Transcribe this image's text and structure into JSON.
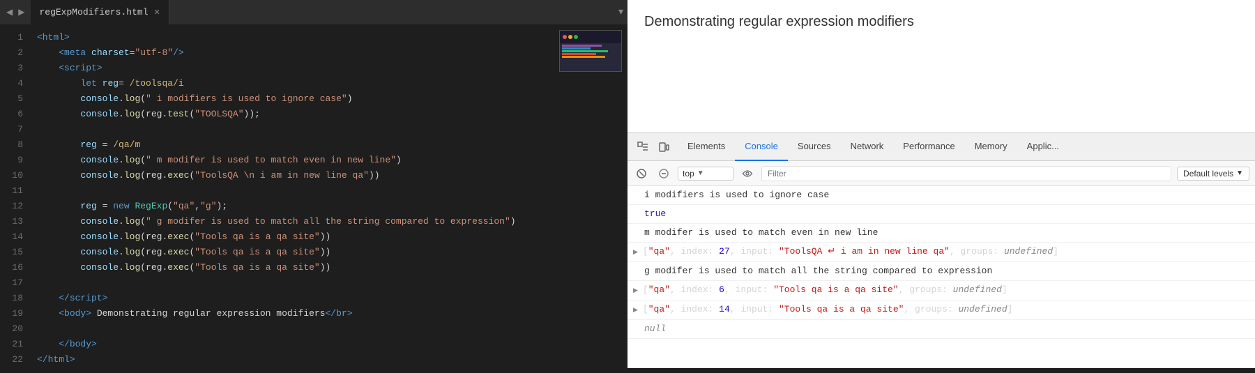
{
  "editor": {
    "tab_name": "regExpModifiers.html",
    "lines": [
      {
        "num": 1,
        "html": "<tag>&lt;html&gt;</tag>"
      },
      {
        "num": 2,
        "html": "    <tag>&lt;meta</tag> <attr-name>charset</attr-name>=<attr-value>\"utf-8\"</attr-value><tag>/&gt;</tag>"
      },
      {
        "num": 3,
        "html": "    <tag>&lt;script&gt;</tag>"
      },
      {
        "num": 4,
        "html": "        <let-kw>let</let-kw> reg= <regex>/toolsqa/i</regex>"
      },
      {
        "num": 5,
        "html": "        <console-word>console</console-word>.<log-word>log</log-word>(<string>\" i modifiers is used to ignore case\"</string>)"
      },
      {
        "num": 6,
        "html": "        <console-word>console</console-word>.<log-word>log</log-word>(reg.<log-word>test</log-word>(<string>\"TOOLSQA\"</string>));"
      },
      {
        "num": 7,
        "html": ""
      },
      {
        "num": 8,
        "html": "        reg = <regex>/qa/m</regex>"
      },
      {
        "num": 9,
        "html": "        <console-word>console</console-word>.<log-word>log</log-word>(<string>\" m modifer is used to match even in new line\"</string>)"
      },
      {
        "num": 10,
        "html": "        <console-word>console</console-word>.<log-word>log</log-word>(reg.<log-word>exec</log-word>(<string>\"ToolsQA \\n i am in new line qa\"</string>))"
      },
      {
        "num": 11,
        "html": ""
      },
      {
        "num": 12,
        "html": "        reg = <new-kw>new</new-kw> <class-name>RegExp</class-name>(<string>\"qa\"</string>,<string>\"g\"</string>);"
      },
      {
        "num": 13,
        "html": "        <console-word>console</console-word>.<log-word>log</log-word>(<string>\" g modifer is used to match all the string compared to expression\"</string>)"
      },
      {
        "num": 14,
        "html": "        <console-word>console</console-word>.<log-word>log</log-word>(reg.<log-word>exec</log-word>(<string>\"Tools qa is a qa site\"</string>))"
      },
      {
        "num": 15,
        "html": "        <console-word>console</console-word>.<log-word>log</log-word>(reg.<log-word>exec</log-word>(<string>\"Tools qa is a qa site\"</string>))"
      },
      {
        "num": 16,
        "html": "        <console-word>console</console-word>.<log-word>log</log-word>(reg.<log-word>exec</log-word>(<string>\"Tools qa is a qa site\"</string>))"
      },
      {
        "num": 17,
        "html": ""
      },
      {
        "num": 18,
        "html": "    <tag>&lt;/script&gt;</tag>"
      },
      {
        "num": 19,
        "html": "    <tag>&lt;body&gt;</tag> Demonstrating regular expression modifiers<tag>&lt;/br&gt;</tag>"
      },
      {
        "num": 20,
        "html": ""
      },
      {
        "num": 21,
        "html": "    <tag>&lt;/body&gt;</tag>"
      },
      {
        "num": 22,
        "html": "<tag>&lt;/html&gt;</tag>"
      }
    ]
  },
  "browser": {
    "page_title": "Demonstrating regular expression modifiers"
  },
  "devtools": {
    "tabs": [
      "Elements",
      "Console",
      "Sources",
      "Network",
      "Performance",
      "Memory",
      "Applic..."
    ],
    "active_tab": "Console",
    "console": {
      "context": "top",
      "filter_placeholder": "Filter",
      "default_levels": "Default levels",
      "output": [
        {
          "type": "text",
          "text": "i modifiers is used to ignore case"
        },
        {
          "type": "true",
          "text": "true"
        },
        {
          "type": "text",
          "text": " m modifer is used to match even in new line"
        },
        {
          "type": "expand",
          "parts": [
            {
              "class": "plain",
              "text": "[\"qa\", index: "
            },
            {
              "class": "c-number",
              "text": "27"
            },
            {
              "class": "plain",
              "text": ", input: "
            },
            {
              "class": "c-string",
              "text": "\"ToolsQA ↵ i am in new line qa\""
            },
            {
              "class": "plain",
              "text": ", groups: "
            },
            {
              "class": "c-italic",
              "text": "undefined"
            },
            {
              "class": "plain",
              "text": "]"
            }
          ]
        },
        {
          "type": "text",
          "text": " g modifer is used to match all the string compared to expression"
        },
        {
          "type": "expand",
          "parts": [
            {
              "class": "plain",
              "text": "[\"qa\", index: "
            },
            {
              "class": "c-number",
              "text": "6"
            },
            {
              "class": "plain",
              "text": ", input: "
            },
            {
              "class": "c-string",
              "text": "\"Tools qa is a qa site\""
            },
            {
              "class": "plain",
              "text": ", groups: "
            },
            {
              "class": "c-italic",
              "text": "undefined"
            },
            {
              "class": "plain",
              "text": "]"
            }
          ]
        },
        {
          "type": "expand",
          "parts": [
            {
              "class": "plain",
              "text": "[\"qa\", index: "
            },
            {
              "class": "c-number",
              "text": "14"
            },
            {
              "class": "plain",
              "text": ", input: "
            },
            {
              "class": "c-string",
              "text": "\"Tools qa is a qa site\""
            },
            {
              "class": "plain",
              "text": ", groups: "
            },
            {
              "class": "c-italic",
              "text": "undefined"
            },
            {
              "class": "plain",
              "text": "]"
            }
          ]
        },
        {
          "type": "null",
          "text": "null"
        }
      ]
    }
  }
}
